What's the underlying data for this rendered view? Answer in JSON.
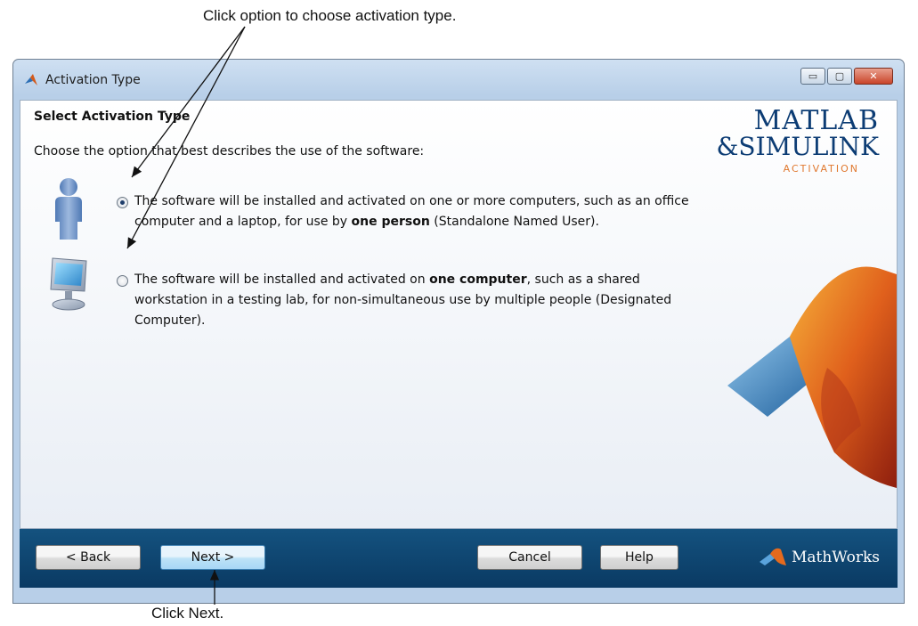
{
  "annotations": {
    "top": "Click option to choose activation type.",
    "bottom": "Click Next."
  },
  "window": {
    "title": "Activation Type",
    "controls": {
      "minimize": "▭",
      "maximize": "▢",
      "close": "✕"
    }
  },
  "content": {
    "heading": "Select Activation Type",
    "subtitle": "Choose the option that best describes the use of the software:",
    "options": [
      {
        "selected": true,
        "pre": "The software will be installed and activated on one or more computers, such as an office computer and a laptop, for use by ",
        "bold": "one person",
        "post": " (Standalone Named User).",
        "icon": "person-icon"
      },
      {
        "selected": false,
        "pre": "The software will be installed and activated on ",
        "bold": "one computer",
        "post": ", such as a shared workstation in a testing lab, for non-simultaneous use by multiple people (Designated Computer).",
        "icon": "computer-icon"
      }
    ]
  },
  "brand": {
    "line1": "MATLAB",
    "line2": "&SIMULINK",
    "line3": "ACTIVATION"
  },
  "footer": {
    "back": "< Back",
    "next": "Next >",
    "cancel": "Cancel",
    "help": "Help",
    "vendor": "MathWorks"
  },
  "colors": {
    "footer_bg": "#0a3a63",
    "brand_blue": "#0c3c74",
    "brand_orange": "#e0782f"
  }
}
